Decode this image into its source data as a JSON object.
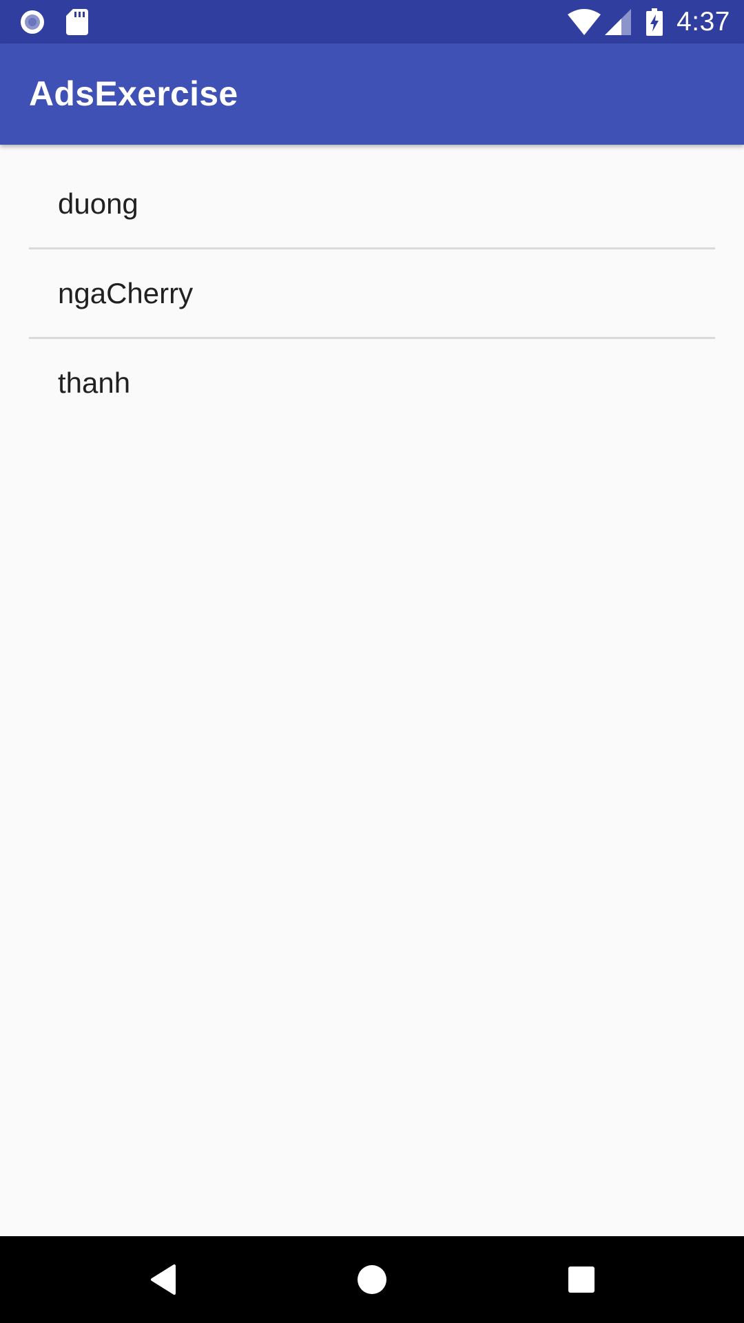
{
  "status_bar": {
    "time": "4:37",
    "left_icons": [
      "record-icon",
      "sd-card-icon"
    ],
    "right_icons": [
      "wifi-icon",
      "cell-signal-icon",
      "battery-charging-icon"
    ]
  },
  "app_bar": {
    "title": "AdsExercise"
  },
  "list": {
    "items": [
      {
        "label": "duong"
      },
      {
        "label": "ngaCherry"
      },
      {
        "label": "thanh"
      }
    ]
  },
  "nav_bar": {
    "buttons": [
      "back-icon",
      "home-icon",
      "recents-icon"
    ]
  },
  "colors": {
    "status_bar": "#303f9f",
    "app_bar": "#3f51b5",
    "background": "#fafafa",
    "divider": "#d9d9d9",
    "text": "#212121"
  }
}
